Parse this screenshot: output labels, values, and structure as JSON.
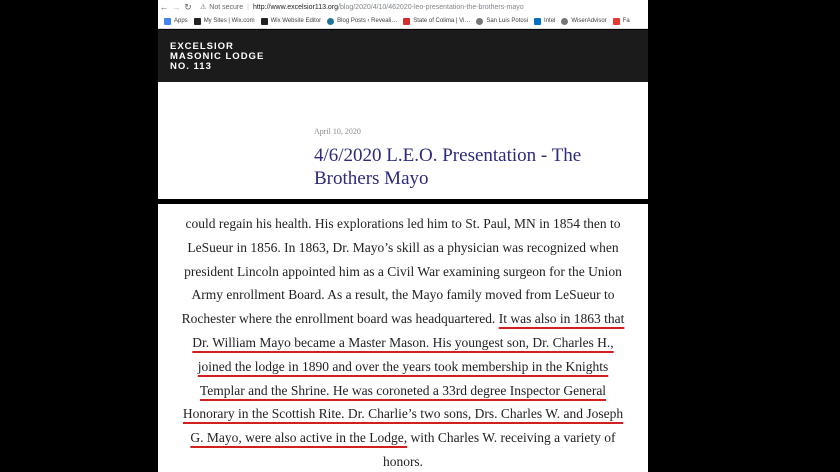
{
  "browser": {
    "security_label": "Not secure",
    "url_host": "http://www.excelsior113.org",
    "url_path": "/blog/2020/4/10/462020-leo-presentation-the-brothers-mayo",
    "bookmarks": [
      "Apps",
      "My Sites | Wix.com",
      "Wix Website Editor",
      "Blog Posts ‹ Reveali…",
      "State of Colima | Vi…",
      "San Luis Potosi",
      "Intel",
      "WiserAdvisor",
      "Fa"
    ]
  },
  "site": {
    "logo_line1": "EXCELSIOR",
    "logo_line2": "MASONIC LODGE",
    "logo_line3": "NO. 113"
  },
  "post": {
    "date": "April 10, 2020",
    "title": "4/6/2020 L.E.O. Presentation - The Brothers Mayo"
  },
  "body": {
    "l1": "could regain his health. His explorations led him to St. Paul, MN in 1854 then to",
    "l2": "LeSueur in 1856. In 1863, Dr. Mayo’s skill as a physician was recognized when",
    "l3": "president Lincoln appointed him as a Civil War examining surgeon for the Union",
    "l4": "Army enrollment Board. As a result, the Mayo family moved from LeSueur to",
    "l5a": "Rochester where the enrollment board was headquartered. ",
    "l5b": "It was also in 1863 that",
    "l6": "Dr. William Mayo became a Master Mason. His youngest son, Dr. Charles H.,",
    "l7": "joined the lodge in 1890 and over the years took membership in the Knights",
    "l8": "Templar and the Shrine. He was coroneted a 33rd degree Inspector General",
    "l9": "Honorary in the Scottish Rite. Dr. Charlie’s two sons, Drs. Charles W. and Joseph",
    "l10a": "G. Mayo, were also active in the Lodge,",
    "l10b": " with Charles W. receiving a variety of",
    "l11": "honors."
  }
}
